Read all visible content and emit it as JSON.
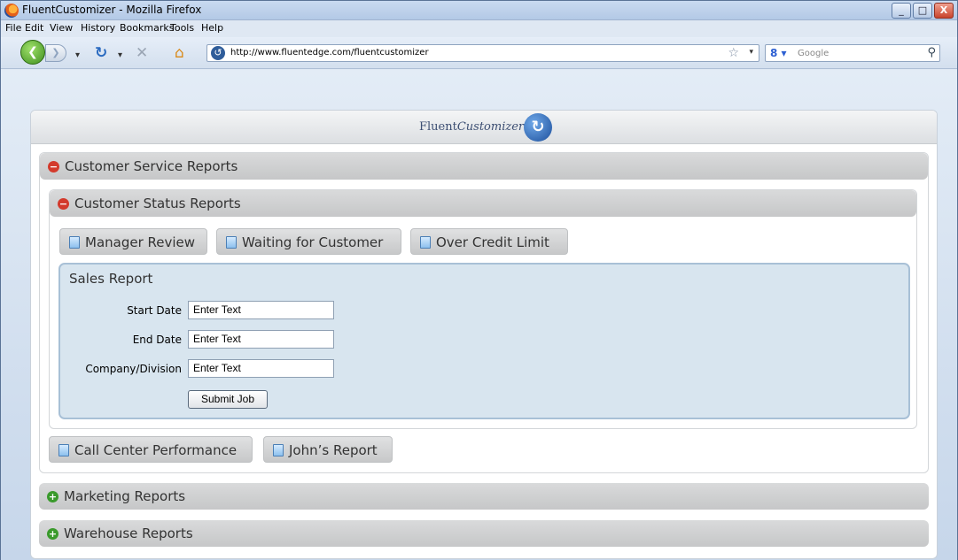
{
  "window": {
    "title": "FluentCustomizer - Mozilla Firefox",
    "buttons": [
      "_",
      "□",
      "X"
    ]
  },
  "menu": [
    "File",
    "Edit",
    "View",
    "History",
    "Bookmarks",
    "Tools",
    "Help"
  ],
  "nav": {
    "url": "http://www.fluentedge.com/fluentcustomizer",
    "search_placeholder": "Google"
  },
  "app": {
    "logo_plain": "Fluent",
    "logo_italic": "Customizer"
  },
  "sections": {
    "customer_service": {
      "label": "Customer Service Reports",
      "status_reports": {
        "label": "Customer Status Reports",
        "buttons": [
          "Manager Review",
          "Waiting for Customer",
          "Over Credit Limit"
        ],
        "form": {
          "title": "Sales Report",
          "fields": [
            {
              "label": "Start Date",
              "value": "Enter Text"
            },
            {
              "label": "End Date",
              "value": "Enter Text"
            },
            {
              "label": "Company/Division",
              "value": "Enter Text"
            }
          ],
          "submit_label": "Submit Job"
        }
      },
      "other_buttons": [
        "Call Center Performance",
        "John’s Report"
      ]
    },
    "marketing": {
      "label": "Marketing Reports"
    },
    "warehouse": {
      "label": "Warehouse Reports"
    }
  }
}
